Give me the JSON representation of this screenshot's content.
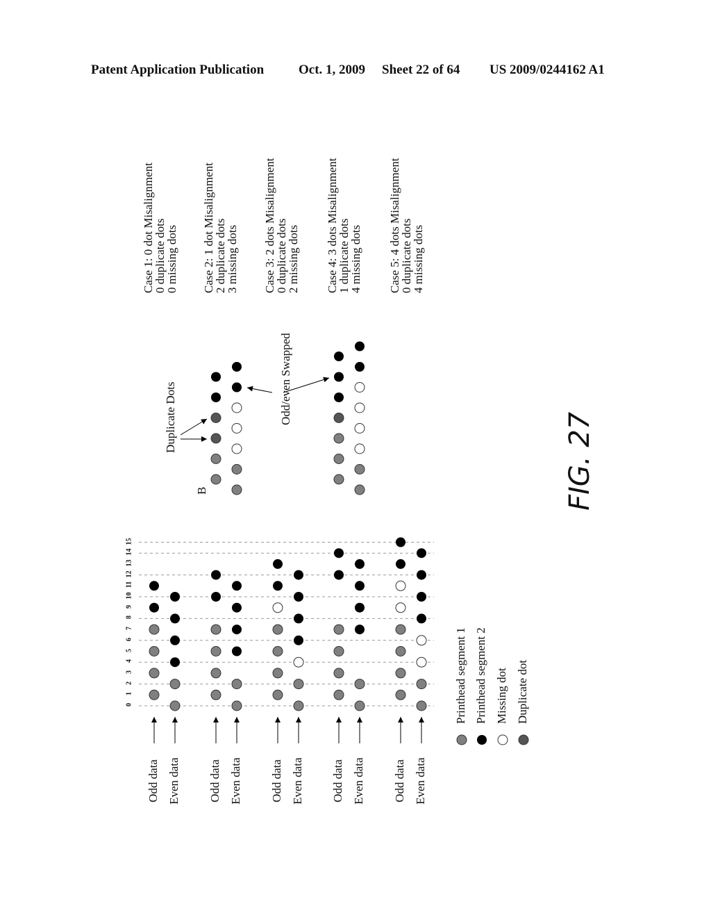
{
  "header": {
    "publication": "Patent Application Publication",
    "date": "Oct. 1, 2009",
    "sheet": "Sheet 22 of 64",
    "number": "US 2009/0244162 A1"
  },
  "figure_label": "FIG. 27",
  "colors": {
    "segment1": "#808080",
    "segment2": "#000000",
    "missing": "#ffffff",
    "duplicate": "#555555"
  },
  "axis_ticks": [
    "0",
    "1",
    "2",
    "3",
    "4",
    "5",
    "6",
    "7",
    "8",
    "9",
    "10",
    "11",
    "12",
    "13",
    "14",
    "15"
  ],
  "row_labels": {
    "odd": "Odd data",
    "even": "Even data"
  },
  "cases": [
    {
      "title": "Case 1: 0 dot Misalignment",
      "duplicates": "0 duplicate dots",
      "missing": "0 missing dots",
      "odd": [
        [
          "s1",
          1
        ],
        [
          "s1",
          3
        ],
        [
          "s1",
          5
        ],
        [
          "s1",
          7
        ],
        [
          "s2",
          9
        ],
        [
          "s2",
          11
        ]
      ],
      "even": [
        [
          "s1",
          0
        ],
        [
          "s1",
          2
        ],
        [
          "s2",
          4
        ],
        [
          "s2",
          6
        ],
        [
          "s2",
          8
        ],
        [
          "s2",
          10
        ]
      ]
    },
    {
      "title": "Case 2: 1 dot Misalignment",
      "duplicates": "2 duplicate dots",
      "missing": "3 missing dots",
      "odd": [
        [
          "s1",
          1
        ],
        [
          "s1",
          3
        ],
        [
          "s1",
          5
        ],
        [
          "s1",
          7
        ],
        [
          "s2",
          10
        ],
        [
          "s2",
          12
        ]
      ],
      "even": [
        [
          "s1",
          0
        ],
        [
          "s1",
          2
        ],
        [
          "s2",
          5
        ],
        [
          "s2",
          7
        ],
        [
          "s2",
          9
        ],
        [
          "s2",
          11
        ]
      ]
    },
    {
      "title": "Case 3: 2 dots Misalignment",
      "duplicates": "0 duplicate dots",
      "missing": "2 missing dots",
      "odd": [
        [
          "s1",
          1
        ],
        [
          "s1",
          3
        ],
        [
          "s1",
          5
        ],
        [
          "s1",
          7
        ],
        [
          "miss",
          9
        ],
        [
          "s2",
          11
        ],
        [
          "s2",
          13
        ]
      ],
      "even": [
        [
          "s1",
          0
        ],
        [
          "s1",
          2
        ],
        [
          "miss",
          4
        ],
        [
          "s2",
          6
        ],
        [
          "s2",
          8
        ],
        [
          "s2",
          10
        ],
        [
          "s2",
          12
        ]
      ]
    },
    {
      "title": "Case 4: 3 dots Misalignment",
      "duplicates": "1 duplicate dots",
      "missing": "4 missing dots",
      "odd": [
        [
          "s1",
          1
        ],
        [
          "s1",
          3
        ],
        [
          "s1",
          5
        ],
        [
          "s1",
          7
        ],
        [
          "s2",
          12
        ],
        [
          "s2",
          14
        ]
      ],
      "even": [
        [
          "s1",
          0
        ],
        [
          "s1",
          2
        ],
        [
          "s2",
          7
        ],
        [
          "s2",
          9
        ],
        [
          "s2",
          11
        ],
        [
          "s2",
          13
        ]
      ]
    },
    {
      "title": "Case 5: 4 dots Misalignment",
      "duplicates": "0 duplicate dots",
      "missing": "4 missing dots",
      "odd": [
        [
          "s1",
          1
        ],
        [
          "s1",
          3
        ],
        [
          "s1",
          5
        ],
        [
          "s1",
          7
        ],
        [
          "miss",
          9
        ],
        [
          "miss",
          11
        ],
        [
          "s2",
          13
        ],
        [
          "s2",
          15
        ]
      ],
      "even": [
        [
          "s1",
          0
        ],
        [
          "s1",
          2
        ],
        [
          "miss",
          4
        ],
        [
          "miss",
          6
        ],
        [
          "s2",
          8
        ],
        [
          "s2",
          10
        ],
        [
          "s2",
          12
        ],
        [
          "s2",
          14
        ]
      ]
    }
  ],
  "detail": {
    "label_b": "B",
    "duplicate_label": "Duplicate Dots",
    "swapped_label": "Odd/even Swapped",
    "row_b_top": [
      "s1",
      "s1",
      "dup",
      "dup",
      "s2",
      "s2"
    ],
    "row_b_bottom": [
      "s1",
      "s1",
      "miss",
      "miss",
      "miss",
      "s2",
      "s2"
    ],
    "row_c_top": [
      "s1",
      "s1",
      "s1",
      "dup",
      "s2",
      "s2",
      "s2"
    ],
    "row_c_bottom": [
      "s1",
      "s1",
      "miss",
      "miss",
      "miss",
      "miss",
      "s2",
      "s2"
    ]
  },
  "legend": [
    {
      "key": "s1",
      "label": "Printhead segment 1"
    },
    {
      "key": "s2",
      "label": "Printhead segment 2"
    },
    {
      "key": "miss",
      "label": "Missing dot"
    },
    {
      "key": "dup",
      "label": "Duplicate dot"
    }
  ]
}
